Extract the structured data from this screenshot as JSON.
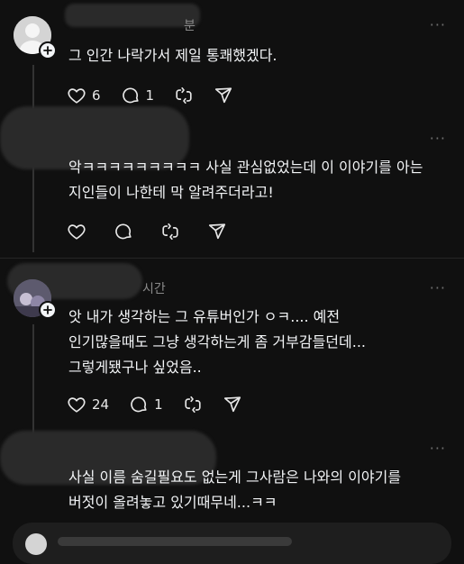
{
  "comments": [
    {
      "time": "분",
      "lines": [
        "그 인간 나락가서 제일 통쾌했겠다."
      ],
      "likes": "6",
      "replies": "1"
    },
    {
      "time": "",
      "lines": [
        "악ㅋㅋㅋㅋㅋㅋㅋㅋㅋ 사실 관심없었는데 이 이야기를 아는",
        "지인들이 나한테 막 알려주더라고!"
      ],
      "likes": "",
      "replies": ""
    },
    {
      "time": "시간",
      "lines": [
        "앗 내가 생각하는 그 유튜버인가 ㅇㅋ.... 예전",
        "인기많을때도 그냥 생각하는게 좀 거부감들던데...",
        "그렇게됐구나 싶었음.."
      ],
      "likes": "24",
      "replies": "1"
    },
    {
      "time": "",
      "lines": [
        "사실 이름 숨길필요도 없는게 그사람은 나와의 이야기를",
        "버젓이 올려놓고 있기때무네...ㅋㅋ"
      ],
      "likes": "",
      "replies": ""
    }
  ],
  "more_label": "···",
  "icons": {
    "like": "heart-icon",
    "reply": "comment-icon",
    "repost": "repost-icon",
    "share": "send-icon",
    "follow": "plus-icon"
  }
}
